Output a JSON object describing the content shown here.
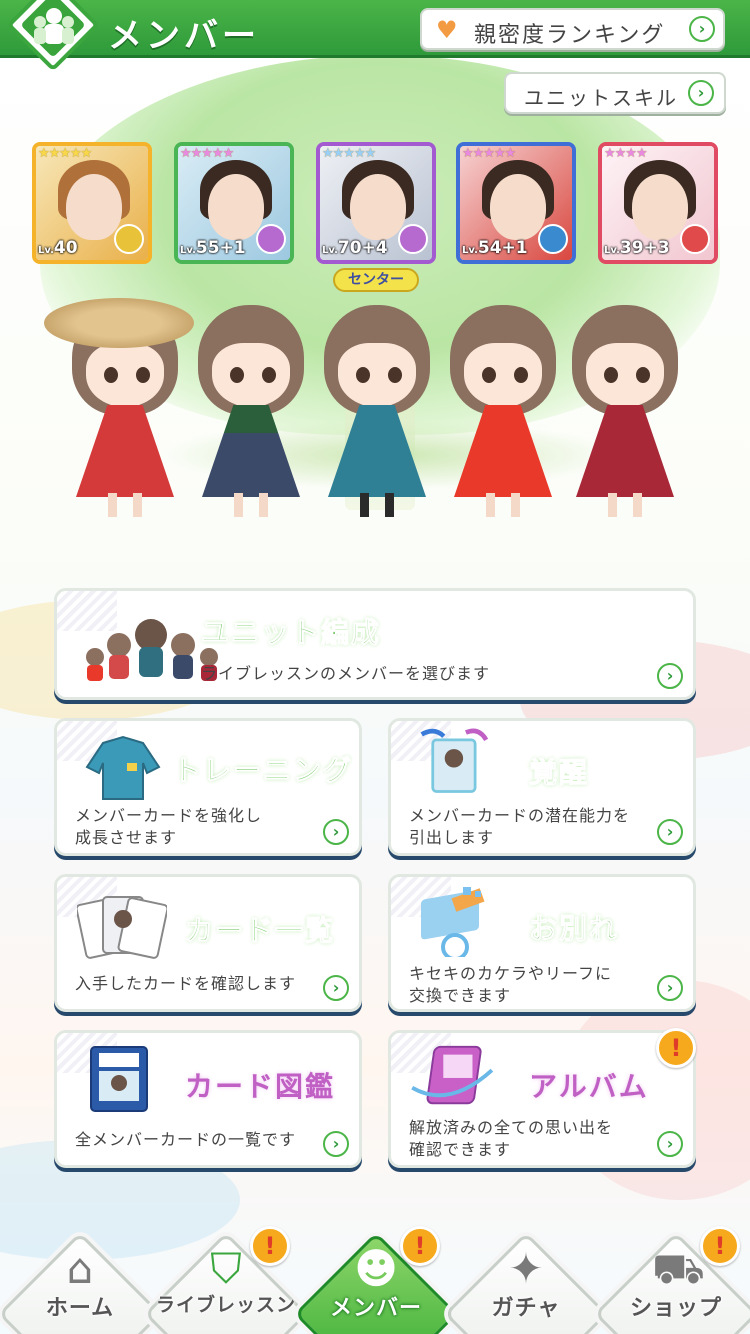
{
  "header": {
    "title": "メンバー",
    "ranking_button": "親密度ランキング"
  },
  "unit_skill_button": "ユニットスキル",
  "cards": [
    {
      "level": "40",
      "stars": "★★★★★",
      "frame_color": "#f4b32a",
      "badge_color": "#e8c33a"
    },
    {
      "level": "55+1",
      "stars": "★★★★★",
      "frame_color": "#49b555",
      "badge_color": "#b66ad0"
    },
    {
      "level": "70+4",
      "stars": "★★★★★",
      "frame_color": "#a35ad0",
      "badge_color": "#b66ad0"
    },
    {
      "level": "54+1",
      "stars": "★★★★★",
      "frame_color": "#3f6fd6",
      "badge_color": "#3a8ad0"
    },
    {
      "level": "39+3",
      "stars": "★★★★",
      "frame_color": "#e04a62",
      "badge_color": "#e04a4a"
    }
  ],
  "center_label": "センター",
  "menu": {
    "unit": {
      "title": "ユニット編成",
      "desc": "ライブレッスンのメンバーを選びます"
    },
    "training": {
      "title": "トレーニング",
      "desc": "メンバーカードを強化し\n成長させます"
    },
    "awaken": {
      "title": "覚醒",
      "desc": "メンバーカードの潜在能力を\n引出します"
    },
    "card_list": {
      "title": "カード一覧",
      "desc": "入手したカードを確認します"
    },
    "farewell": {
      "title": "お別れ",
      "desc": "キセキのカケラやリーフに\n交換できます"
    },
    "card_book": {
      "title": "カード図鑑",
      "desc": "全メンバーカードの一覧です"
    },
    "album": {
      "title": "アルバム",
      "desc": "解放済みの全ての思い出を\n確認できます"
    }
  },
  "alert_mark": "!",
  "nav": [
    {
      "label": "ホーム",
      "icon": "home-icon",
      "glyph": "⌂",
      "alert": false,
      "active": false
    },
    {
      "label": "ライブレッスン",
      "icon": "shield-icon",
      "glyph": "⛉",
      "alert": true,
      "active": false
    },
    {
      "label": "メンバー",
      "icon": "members-icon",
      "glyph": "☻",
      "alert": true,
      "active": true
    },
    {
      "label": "ガチャ",
      "icon": "gacha-icon",
      "glyph": "✦",
      "alert": false,
      "active": false
    },
    {
      "label": "ショップ",
      "icon": "cart-icon",
      "glyph": "⛟",
      "alert": true,
      "active": false
    }
  ],
  "icons": {
    "heart": "♥",
    "chevron": "›"
  }
}
